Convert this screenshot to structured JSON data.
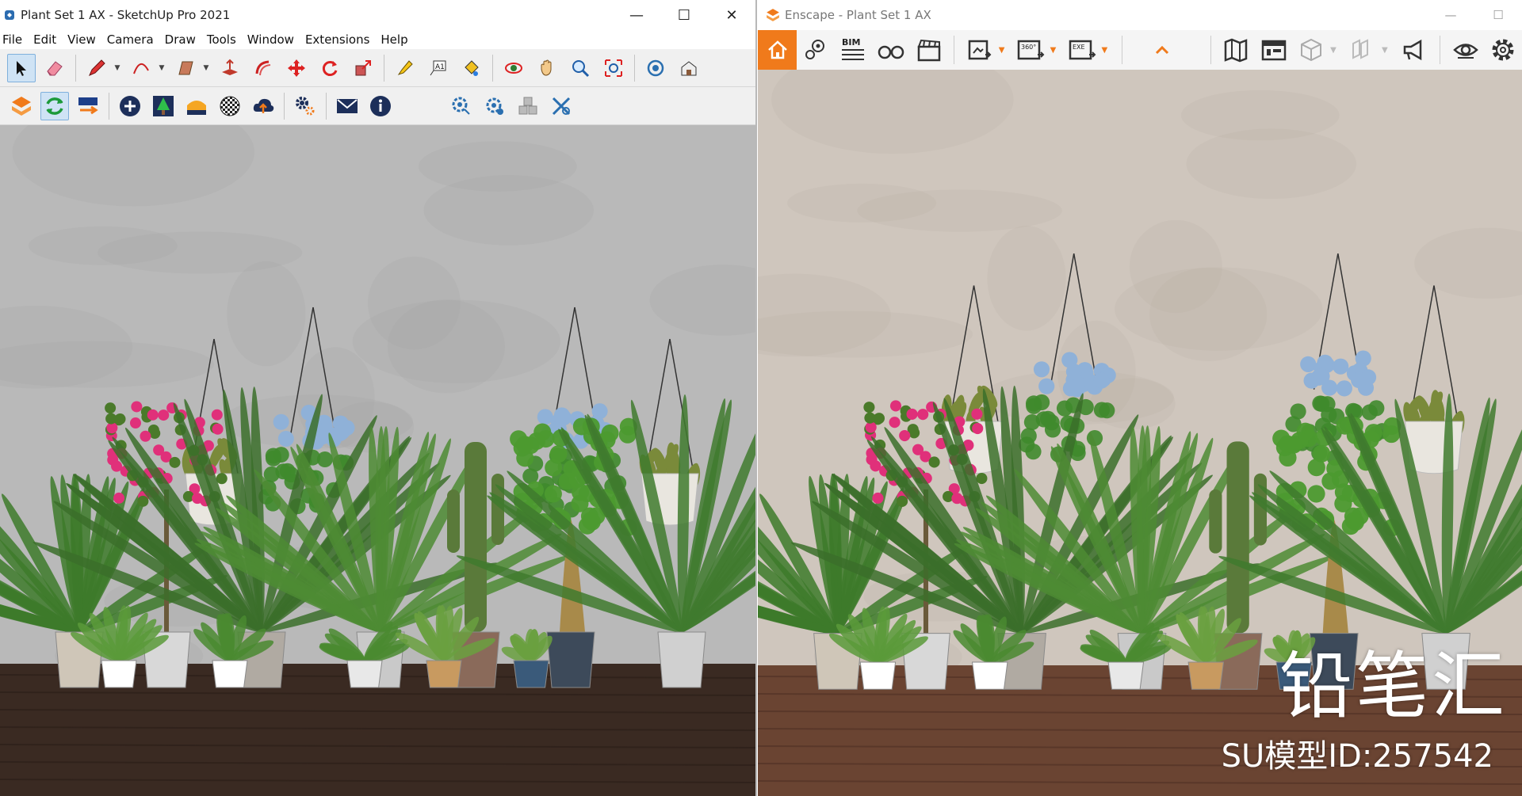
{
  "sketchup": {
    "title": "Plant Set 1 AX - SketchUp Pro 2021",
    "window_controls": {
      "minimize": "—",
      "maximize": "☐",
      "close": "✕"
    },
    "menu": [
      "File",
      "Edit",
      "View",
      "Camera",
      "Draw",
      "Tools",
      "Window",
      "Extensions",
      "Help"
    ]
  },
  "enscape": {
    "title": "Enscape - Plant Set 1 AX",
    "toolbar_labels": {
      "bim": "BIM",
      "vr360": "360°",
      "exe": "EXE"
    },
    "window_controls": {
      "minimize": "—",
      "maximize": "☐"
    }
  },
  "overlay": {
    "brand": "铅笔汇",
    "model_id": "SU模型ID:257542"
  },
  "colors": {
    "enscape_accent": "#f07a1b",
    "sketchup_wall": "#b9b9b9",
    "enscape_wall": "#cfc6bd",
    "floor_dark": "#3a2a22",
    "floor_warm": "#6a4432",
    "flower_pink": "#e0307a",
    "flower_blue": "#8fb1d8",
    "leaf_green": "#3f8a2c"
  }
}
